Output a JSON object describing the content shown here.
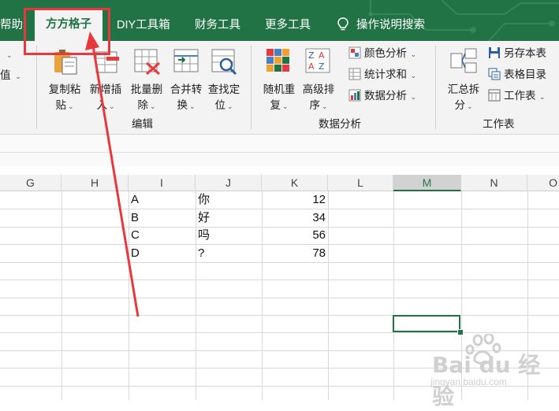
{
  "tabs": {
    "help": "帮助",
    "fangfang": "方方格子",
    "diy": "DIY工具箱",
    "finance": "财务工具",
    "more": "更多工具",
    "search": "操作说明搜索"
  },
  "ribbon": {
    "left_partial": [
      "值"
    ],
    "edit_buttons": [
      {
        "l1": "复制粘",
        "l2": "贴",
        "icon": "copy-paste-icon"
      },
      {
        "l1": "新增插",
        "l2": "入",
        "icon": "insert-icon"
      },
      {
        "l1": "批量删",
        "l2": "除",
        "icon": "batch-delete-icon"
      },
      {
        "l1": "合并转",
        "l2": "换",
        "icon": "merge-convert-icon"
      },
      {
        "l1": "查找定",
        "l2": "位",
        "icon": "find-locate-icon"
      }
    ],
    "edit_group_label": "编辑",
    "analysis_buttons": [
      {
        "l1": "随机重",
        "l2": "复",
        "icon": "random-repeat-icon"
      },
      {
        "l1": "高级排",
        "l2": "序",
        "icon": "advanced-sort-icon"
      }
    ],
    "analysis_small": [
      {
        "label": "颜色分析",
        "icon": "color-analysis-icon"
      },
      {
        "label": "统计求和",
        "icon": "stat-sum-icon"
      },
      {
        "label": "数据分析",
        "icon": "data-analysis-icon"
      }
    ],
    "analysis_group_label": "数据分析",
    "sheet_button": {
      "l1": "汇总拆",
      "l2": "分",
      "icon": "summary-split-icon"
    },
    "sheet_small": [
      {
        "label": "另存本表",
        "icon": "save-as-sheet-icon"
      },
      {
        "label": "表格目录",
        "icon": "sheet-directory-icon"
      },
      {
        "label": "工作表",
        "icon": "worksheet-icon"
      }
    ],
    "sheet_group_label": "工作表"
  },
  "sheet": {
    "columns": [
      "G",
      "H",
      "I",
      "J",
      "K",
      "L",
      "M",
      "N",
      "O"
    ],
    "selected_column": "M",
    "rows": [
      {
        "I": "A",
        "J": "你",
        "K": "12"
      },
      {
        "I": "B",
        "J": "好",
        "K": "34"
      },
      {
        "I": "C",
        "J": "吗",
        "K": "56"
      },
      {
        "I": "D",
        "J": "?",
        "K": "78"
      }
    ]
  },
  "colors": {
    "ribbon_green": "#217346",
    "annotation_red": "#e8383d"
  },
  "watermark": {
    "text": "Bai du 经验",
    "sub": "jingyan.baidu.com"
  }
}
